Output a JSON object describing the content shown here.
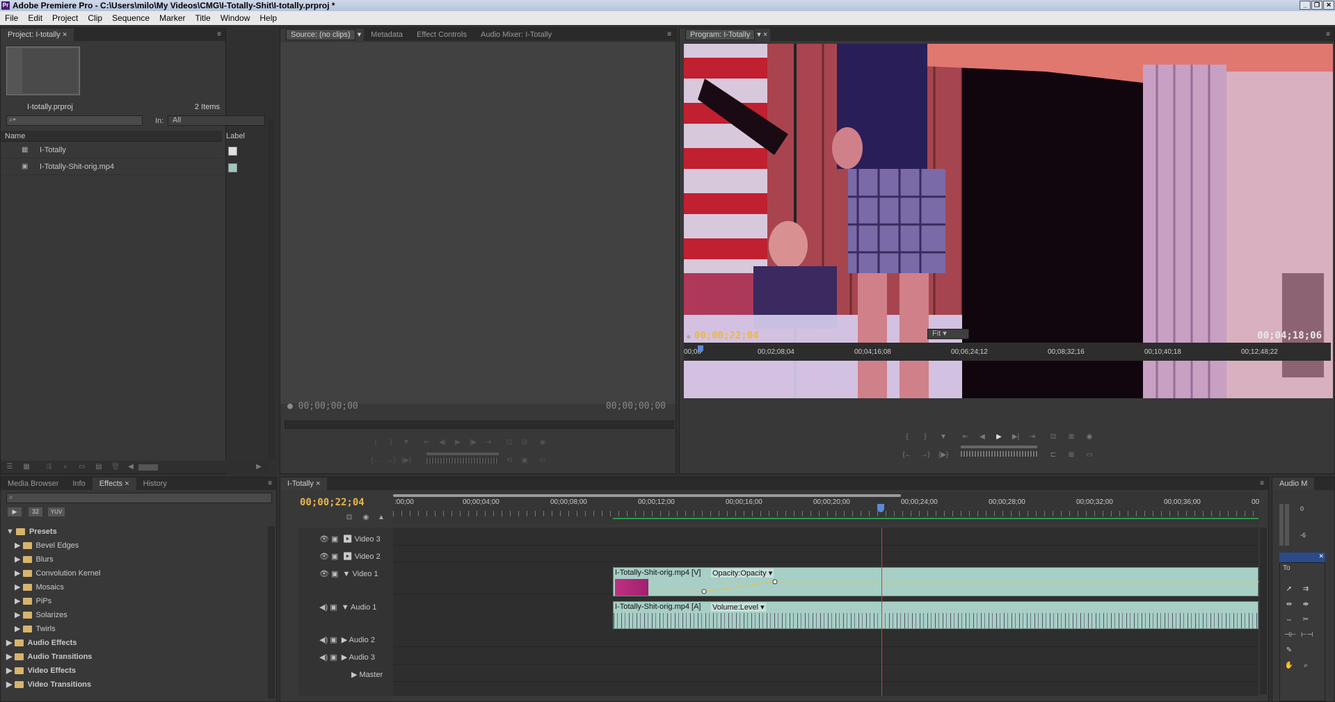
{
  "window": {
    "title": "Adobe Premiere Pro - C:\\Users\\milo\\My Videos\\CMG\\I-Totally-Shit\\I-totally.prproj *"
  },
  "menu": [
    "File",
    "Edit",
    "Project",
    "Clip",
    "Sequence",
    "Marker",
    "Title",
    "Window",
    "Help"
  ],
  "project_panel": {
    "tab": "Project: I-totally",
    "project_file": "I-totally.prproj",
    "item_count": "2 Items",
    "in_label": "In:",
    "in_value": "All",
    "col_name": "Name",
    "col_label": "Label",
    "items": [
      {
        "name": "I-Totally",
        "color": "#e0e0e0"
      },
      {
        "name": "I-Totally-Shit-orig.mp4",
        "color": "#9ec7c0"
      }
    ]
  },
  "source_panel": {
    "tabs": [
      "Source: (no clips)",
      "Metadata",
      "Effect Controls",
      "Audio Mixer: I-Totally"
    ],
    "timecode_left": "00;00;00;00",
    "timecode_right": "00;00;00;00"
  },
  "program_panel": {
    "tab": "Program: I-Totally",
    "timecode_current": "00;00;22;04",
    "timecode_duration": "00;04;18;06",
    "fit": "Fit",
    "ruler": [
      "00;00",
      "00;02;08;04",
      "00;04;16;08",
      "00;06;24;12",
      "00;08;32;16",
      "00;10;40;18",
      "00;12;48;22"
    ]
  },
  "effects_panel": {
    "tabs": [
      "Media Browser",
      "Info",
      "Effects",
      "History"
    ],
    "presets_label": "Presets",
    "presets": [
      "Bevel Edges",
      "Blurs",
      "Convolution Kernel",
      "Mosaics",
      "PiPs",
      "Solarizes",
      "Twirls"
    ],
    "categories": [
      "Audio Effects",
      "Audio Transitions",
      "Video Effects",
      "Video Transitions"
    ],
    "toolbar_labels": [
      "32",
      "YUV"
    ]
  },
  "timeline": {
    "tab": "I-Totally",
    "timecode": "00;00;22;04",
    "ruler": [
      ":00;00",
      "00;00;04;00",
      "00;00;08;00",
      "00;00;12;00",
      "00;00;16;00",
      "00;00;20;00",
      "00;00;24;00",
      "00;00;28;00",
      "00;00;32;00",
      "00;00;36;00",
      "00"
    ],
    "video_tracks": [
      "Video 3",
      "Video 2",
      "Video 1"
    ],
    "audio_tracks": [
      "Audio 1",
      "Audio 2",
      "Audio 3",
      "Master"
    ],
    "video_clip": {
      "name": "I-Totally-Shit-orig.mp4 [V]",
      "effect": "Opacity:Opacity"
    },
    "audio_clip": {
      "name": "I-Totally-Shit-orig.mp4 [A]",
      "effect": "Volume:Level"
    }
  },
  "audio_meter": {
    "tab": "Audio M",
    "scale_top": "0",
    "scale_mid": "-6"
  },
  "tools": {
    "tab": "To"
  },
  "colors": {
    "accent_timecode": "#e8b84a",
    "clip_fill": "#a7cfc6",
    "playhead": "#d93a2a"
  }
}
